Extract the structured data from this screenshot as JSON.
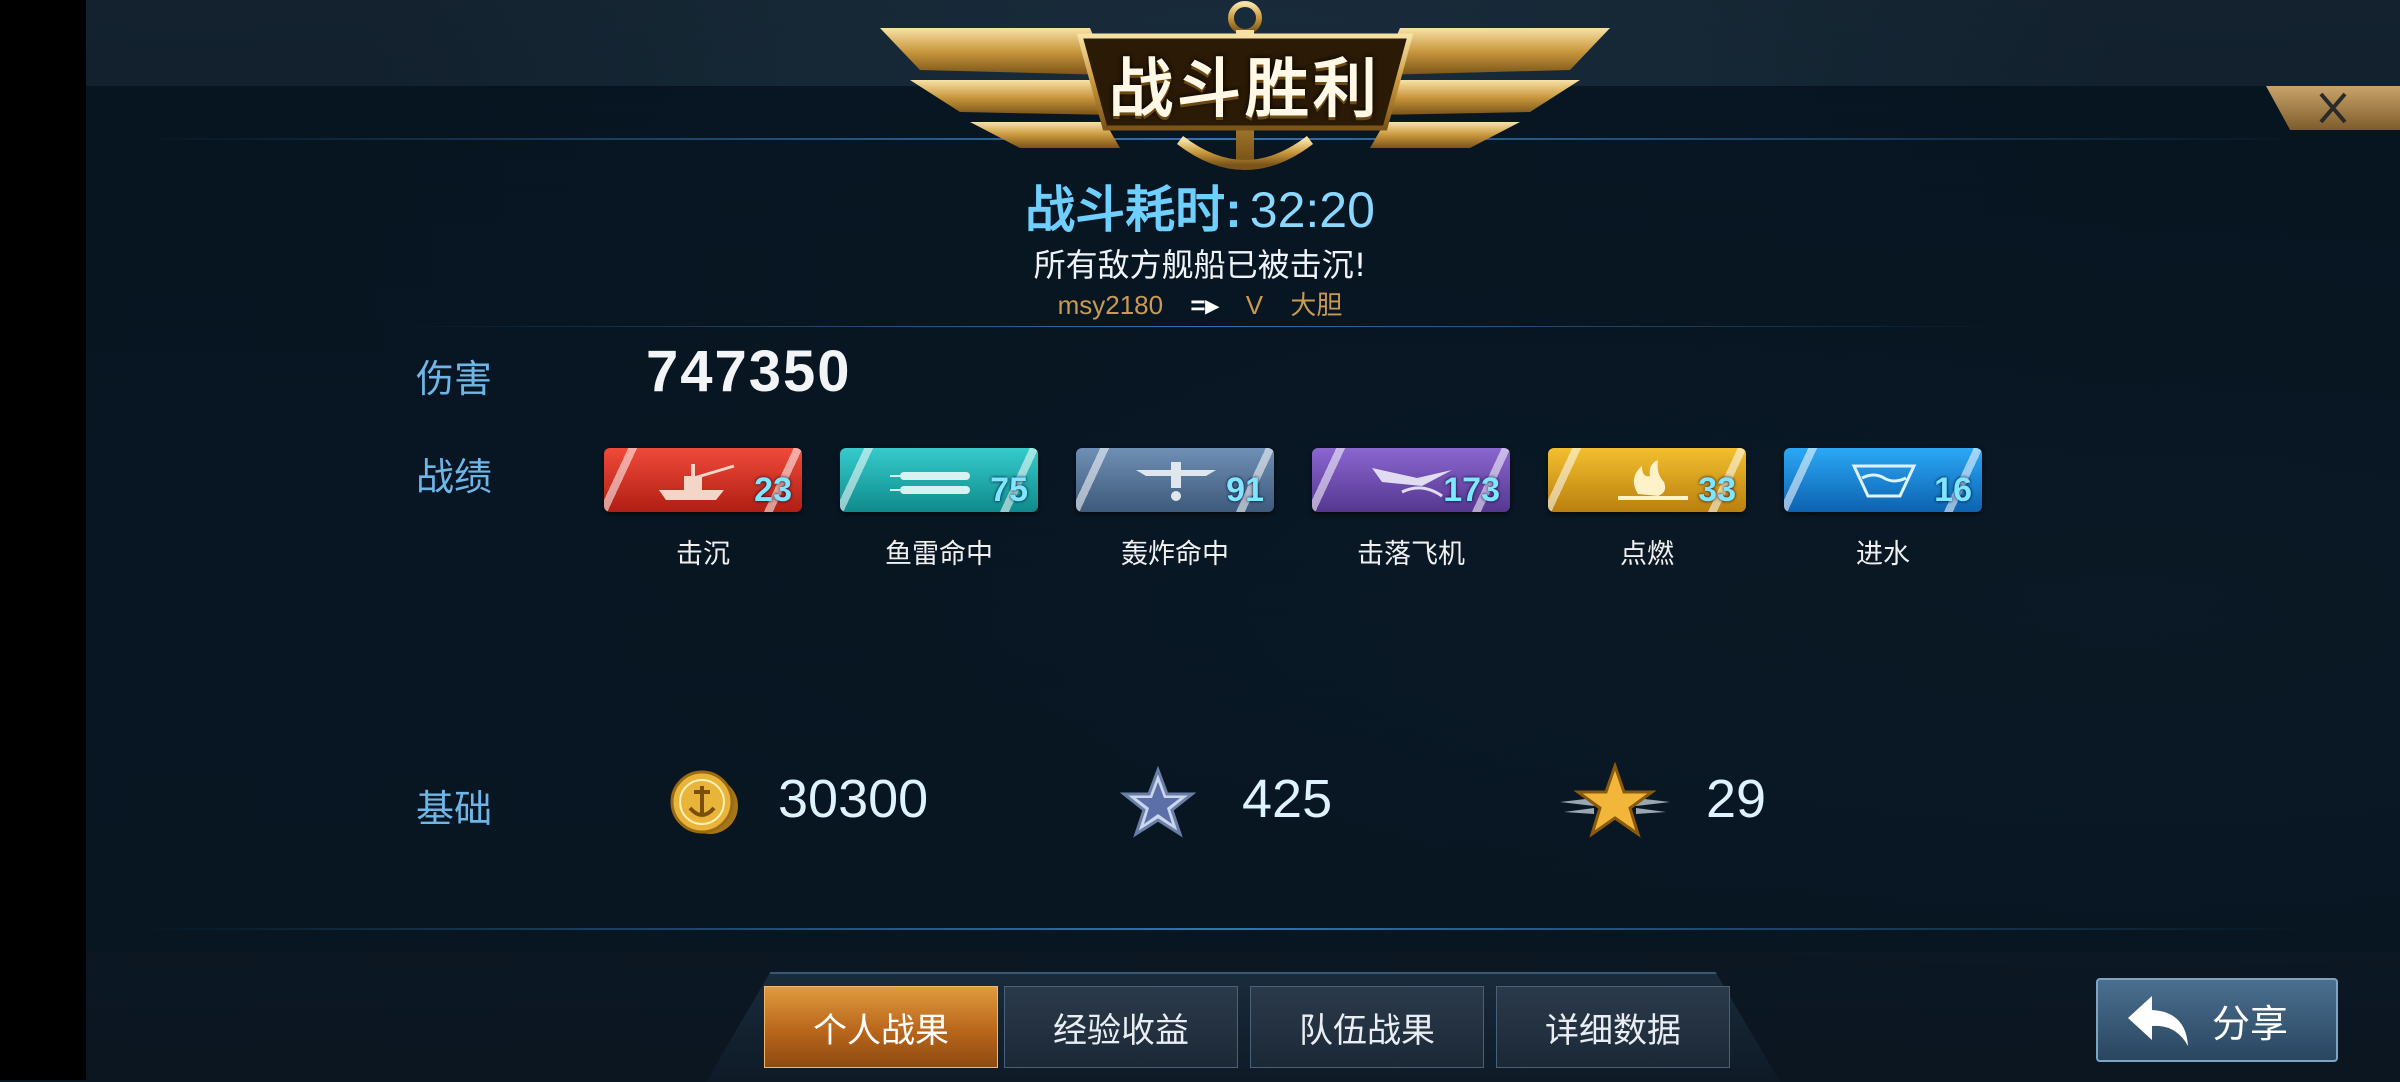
{
  "header": {
    "title": "战斗胜利",
    "duration_label": "战斗耗时:",
    "duration_value": "32:20",
    "subtitle": "所有敌方舰船已被击沉!",
    "player_name": "msy2180",
    "player_arrow": "=▸",
    "player_rank": "V",
    "player_trait": "大胆"
  },
  "damage": {
    "label": "伤害",
    "value": "747350"
  },
  "record": {
    "label": "战绩",
    "items": [
      {
        "label": "击沉",
        "value": "23",
        "icon": "ship-sink-icon",
        "color": "#d9332b"
      },
      {
        "label": "鱼雷命中",
        "value": "75",
        "icon": "torpedo-icon",
        "color": "#1fb0b0"
      },
      {
        "label": "轰炸命中",
        "value": "91",
        "icon": "bomber-icon",
        "color": "#4e6f94"
      },
      {
        "label": "击落飞机",
        "value": "173",
        "icon": "plane-shot-icon",
        "color": "#6d4fb2"
      },
      {
        "label": "点燃",
        "value": "33",
        "icon": "fire-icon",
        "color": "#e2a51a"
      },
      {
        "label": "进水",
        "value": "16",
        "icon": "flood-icon",
        "color": "#1e8ee0"
      }
    ]
  },
  "base": {
    "label": "基础",
    "coins": {
      "value": "30300",
      "icon": "gold-coin-icon"
    },
    "exp": {
      "value": "425",
      "icon": "silver-star-icon"
    },
    "rank": {
      "value": "29",
      "icon": "gold-star-wings-icon"
    }
  },
  "tabs": [
    {
      "label": "个人战果",
      "active": true
    },
    {
      "label": "经验收益",
      "active": false
    },
    {
      "label": "队伍战果",
      "active": false
    },
    {
      "label": "详细数据",
      "active": false
    }
  ],
  "share": {
    "label": "分享",
    "icon": "share-arrow-icon"
  },
  "close": {
    "icon": "close-icon"
  }
}
